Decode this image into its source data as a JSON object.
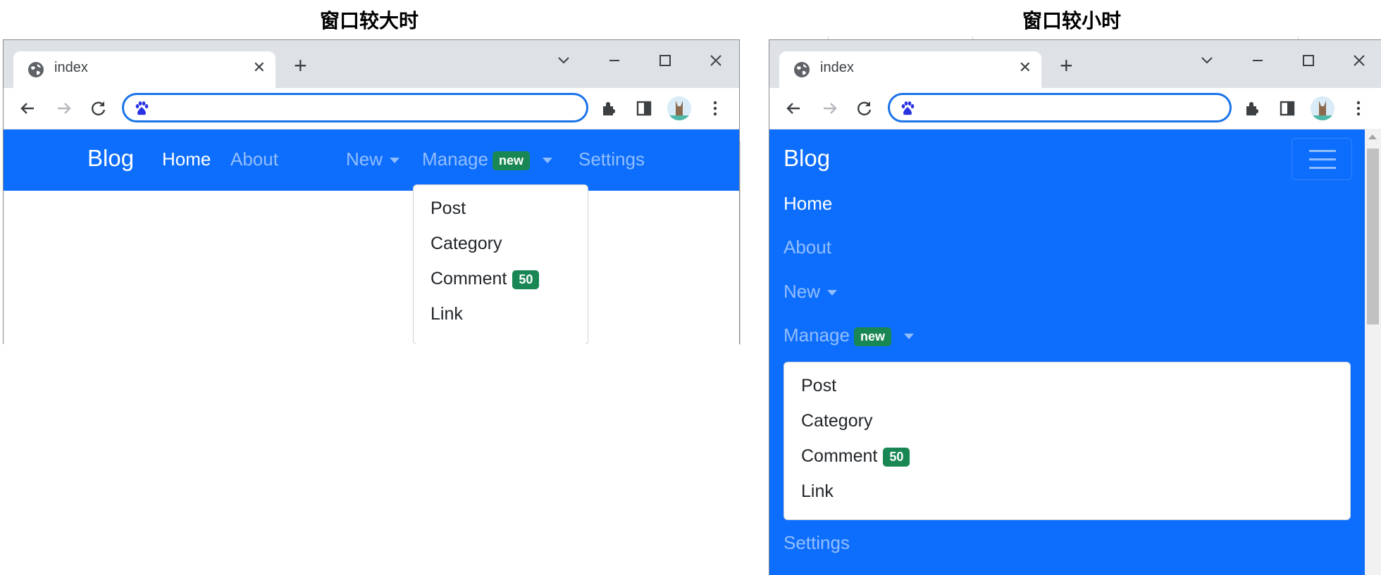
{
  "captions": {
    "left": "窗口较大时",
    "right": "窗口较小时"
  },
  "browser": {
    "tab_title": "index",
    "tab_close": "✕",
    "new_tab": "+"
  },
  "colors": {
    "navbar": "#0d6efd",
    "badge": "#198754",
    "omnibox_border": "#1a73e8"
  },
  "navbar": {
    "brand": "Blog",
    "links": {
      "home": "Home",
      "about": "About",
      "new": "New",
      "manage": "Manage",
      "settings": "Settings"
    },
    "manage_badge": "new"
  },
  "dropdown": {
    "items": {
      "post": "Post",
      "category": "Category",
      "comment": "Comment",
      "link": "Link"
    },
    "comment_badge": "50"
  }
}
